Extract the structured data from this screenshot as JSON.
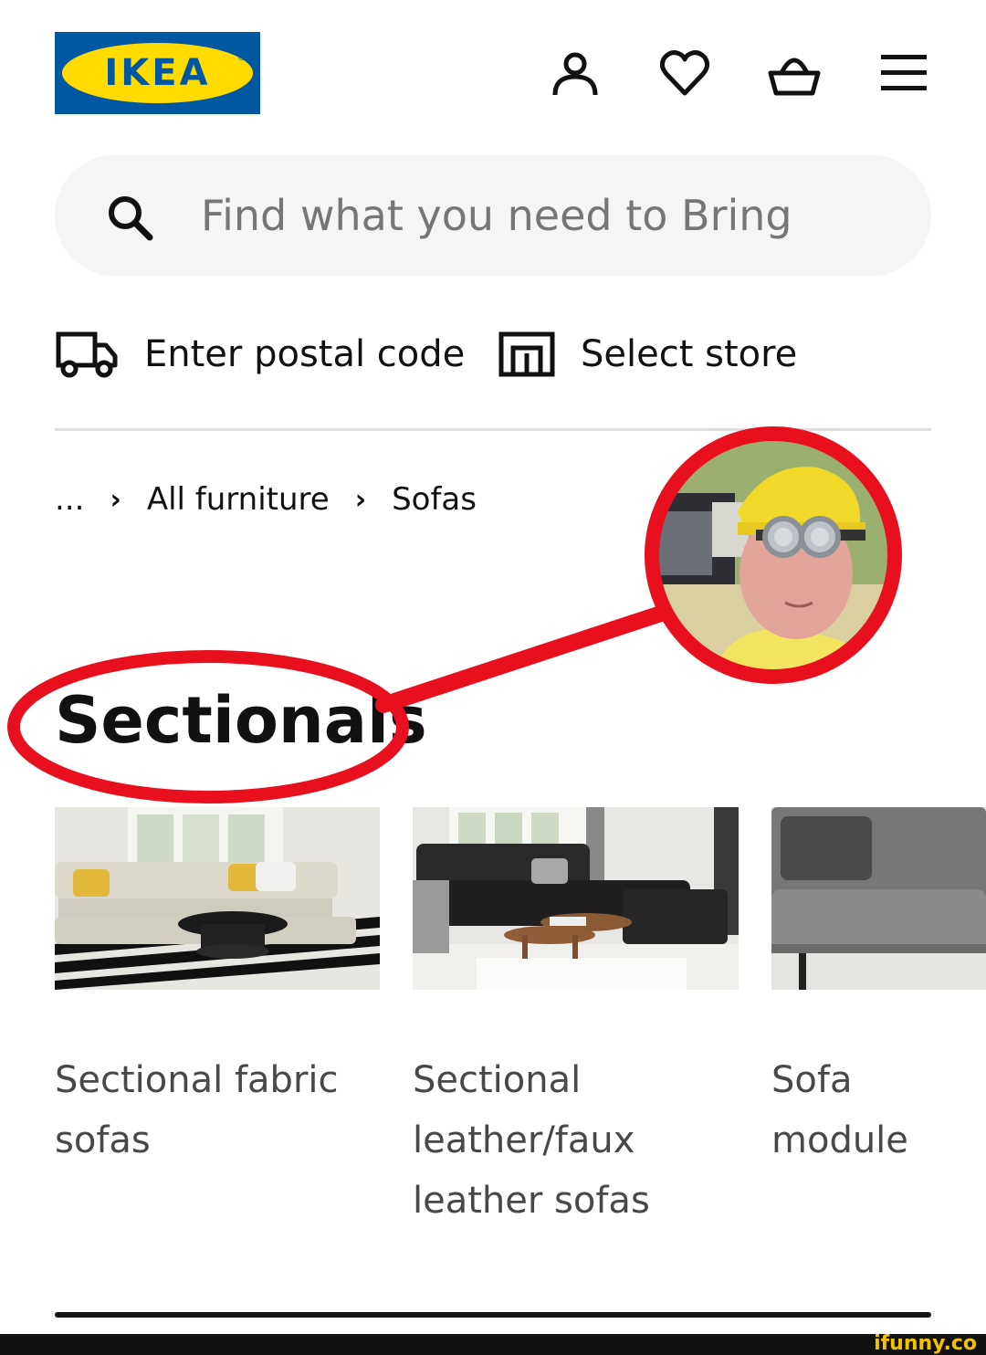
{
  "header": {
    "logo_text": "IKEA",
    "logo_reg": "®",
    "icons": [
      "person-icon",
      "heart-icon",
      "basket-icon",
      "menu-icon"
    ]
  },
  "search": {
    "placeholder": "Find what you need to Bring"
  },
  "location": {
    "postal_label": "Enter postal code",
    "store_label": "Select store"
  },
  "breadcrumb": {
    "ellipsis": "...",
    "items": [
      "All furniture",
      "Sofas"
    ]
  },
  "page": {
    "title": "Sectionals"
  },
  "cards": [
    {
      "label": "Sectional fabric\nsofas"
    },
    {
      "label": "Sectional\nleather/faux\nleather sofas"
    },
    {
      "label": "Sofa module"
    }
  ],
  "colors": {
    "ikea_blue": "#0058a3",
    "ikea_yellow": "#ffdb00",
    "annotation_red": "#e8101e"
  },
  "footer": {
    "watermark": "ifunny.co"
  }
}
